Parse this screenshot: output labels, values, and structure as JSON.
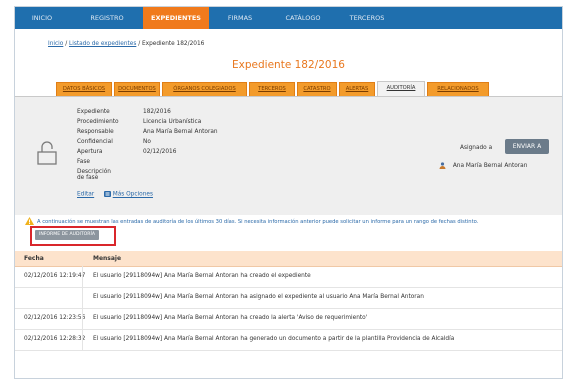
{
  "nav": {
    "items": [
      "INICIO",
      "REGISTRO",
      "EXPEDIENTES",
      "FIRMAS",
      "CATÁLOGO",
      "TERCEROS"
    ],
    "active": "EXPEDIENTES"
  },
  "breadcrumb": {
    "home": "Inicio",
    "list": "Listado de expedientes",
    "current": "Expediente 182/2016"
  },
  "page_title": "Expediente 182/2016",
  "tabs": [
    "DATOS BÁSICOS",
    "DOCUMENTOS",
    "ÓRGANOS COLEGIADOS",
    "TERCEROS",
    "CATASTRO",
    "ALERTAS",
    "AUDITORÍA",
    "RELACIONADOS"
  ],
  "active_tab": "AUDITORÍA",
  "details": {
    "fields": [
      {
        "label": "Expediente",
        "value": "182/2016"
      },
      {
        "label": "Procedimiento",
        "value": "Licencia Urbanística"
      },
      {
        "label": "Responsable",
        "value": "Ana María Bernal Antoran"
      },
      {
        "label": "Confidencial",
        "value": "No"
      },
      {
        "label": "Apertura",
        "value": "02/12/2016"
      },
      {
        "label": "Fase",
        "value": ""
      },
      {
        "label": "Descripción de fase",
        "value": ""
      }
    ],
    "edit_link": "Editar",
    "more_options_link": "Más Opciones",
    "assigned_label": "Asignado a",
    "send_button": "ENVIAR A",
    "assigned_user": "Ana María Bernal Antoran"
  },
  "notice": {
    "text": "A continuación se muestran las entradas de auditoría de los últimos 30 días. Si necesita información anterior puede solicitar un informe para un rango de fechas distinto.",
    "report_button": "INFORME DE AUDITORÍA"
  },
  "audit_table": {
    "headers": [
      "Fecha",
      "Mensaje"
    ],
    "rows": [
      {
        "fecha": "02/12/2016 12:19:47",
        "mensaje": "El usuario [29118094w] Ana María Bernal Antoran ha creado el expediente"
      },
      {
        "fecha": "",
        "mensaje": "El usuario [29118094w] Ana María Bernal Antoran ha asignado el expediente al usuario Ana María Bernal Antoran"
      },
      {
        "fecha": "02/12/2016 12:23:56",
        "mensaje": "El usuario [29118094w] Ana María Bernal Antoran ha creado la alerta 'Aviso de requerimiento'"
      },
      {
        "fecha": "02/12/2016 12:28:32",
        "mensaje": "El usuario [29118094w] Ana María Bernal Antoran ha generado un documento a partir de la plantilla Providencia de Alcaldía"
      }
    ]
  },
  "colors": {
    "nav_bg": "#1f6fae",
    "accent": "#f07a1c",
    "tab_orange": "#f39b2b",
    "link": "#2a69a8",
    "highlight_box": "#d9262b"
  }
}
